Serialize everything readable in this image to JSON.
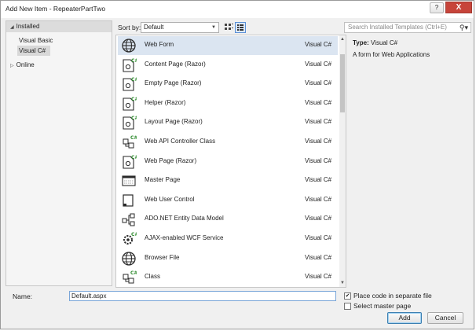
{
  "window": {
    "title": "Add New Item - RepeaterPartTwo",
    "help_label": "?",
    "close_label": "X"
  },
  "left_panel": {
    "installed_label": "Installed",
    "languages": [
      "Visual Basic",
      "Visual C#"
    ],
    "selected_language": "Visual C#",
    "online_label": "Online"
  },
  "toolbar": {
    "sort_label": "Sort by:",
    "sort_value": "Default",
    "search_placeholder": "Search Installed Templates (Ctrl+E)"
  },
  "templates": [
    {
      "name": "Web Form",
      "lang": "Visual C#",
      "icon": "globe-icon",
      "selected": true
    },
    {
      "name": "Content Page (Razor)",
      "lang": "Visual C#",
      "icon": "razor-page-icon"
    },
    {
      "name": "Empty Page (Razor)",
      "lang": "Visual C#",
      "icon": "razor-page-icon"
    },
    {
      "name": "Helper (Razor)",
      "lang": "Visual C#",
      "icon": "razor-page-icon"
    },
    {
      "name": "Layout Page (Razor)",
      "lang": "Visual C#",
      "icon": "razor-page-icon"
    },
    {
      "name": "Web API Controller Class",
      "lang": "Visual C#",
      "icon": "class-icon"
    },
    {
      "name": "Web Page (Razor)",
      "lang": "Visual C#",
      "icon": "razor-page-icon"
    },
    {
      "name": "Master Page",
      "lang": "Visual C#",
      "icon": "master-page-icon"
    },
    {
      "name": "Web User Control",
      "lang": "Visual C#",
      "icon": "user-control-icon"
    },
    {
      "name": "ADO.NET Entity Data Model",
      "lang": "Visual C#",
      "icon": "entity-model-icon"
    },
    {
      "name": "AJAX-enabled WCF Service",
      "lang": "Visual C#",
      "icon": "wcf-service-icon"
    },
    {
      "name": "Browser File",
      "lang": "Visual C#",
      "icon": "globe-icon"
    },
    {
      "name": "Class",
      "lang": "Visual C#",
      "icon": "class-icon"
    }
  ],
  "details": {
    "type_label": "Type:",
    "type_value": "Visual C#",
    "description": "A form for Web Applications"
  },
  "bottom": {
    "name_label": "Name:",
    "name_value": "Default.aspx",
    "separate_file_label": "Place code in separate file",
    "separate_file_checked": true,
    "master_page_label": "Select master page",
    "master_page_checked": false,
    "add_label": "Add",
    "cancel_label": "Cancel"
  }
}
